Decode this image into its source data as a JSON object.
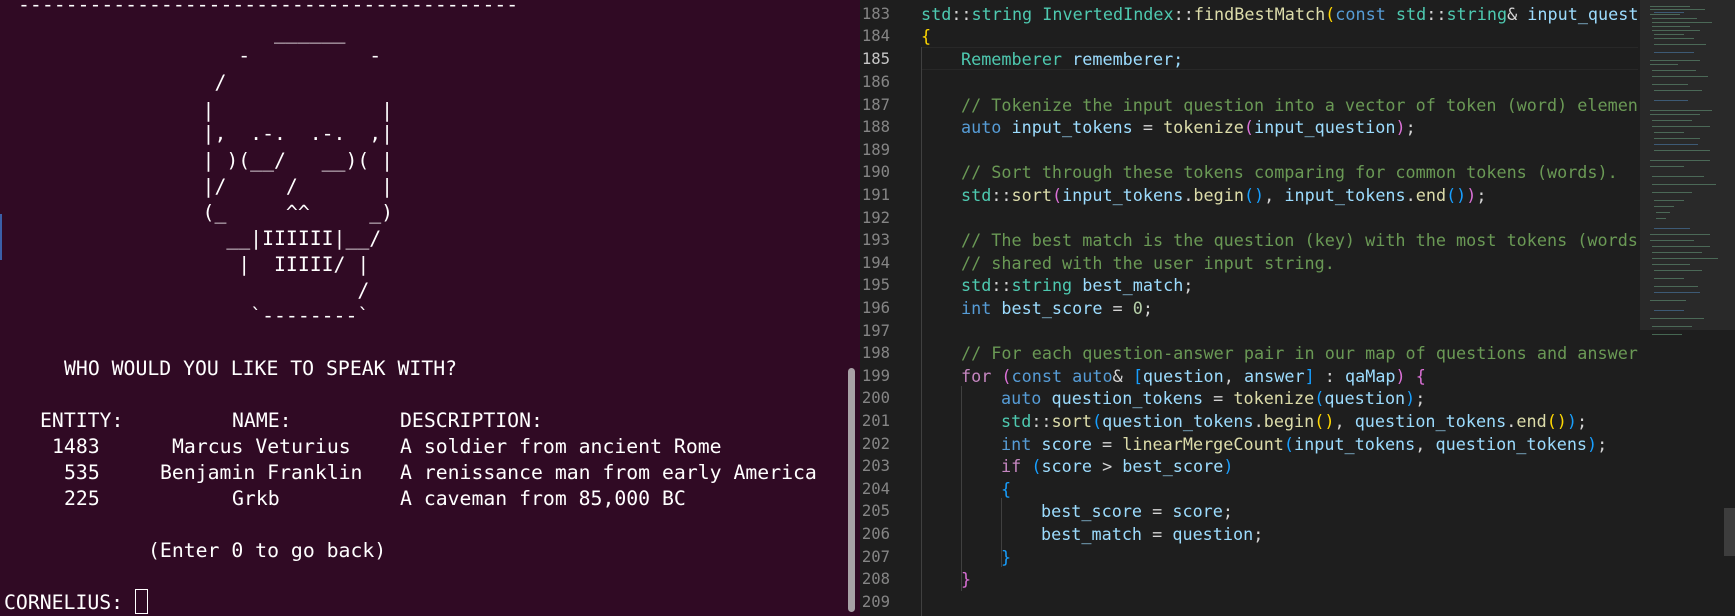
{
  "terminal": {
    "rule": "------------------------------------------",
    "ascii_art": [
      "           ______",
      "        -          -",
      "      /",
      "     |              |",
      "     |,  .-.  .-.  ,|",
      "     | )(__/   __)( |",
      "     |/     /       |",
      "     (_     ^^     _)",
      "       __|IIIIII|__/",
      "        |  IIIII/ |",
      "                  /",
      "         `--------`"
    ],
    "prompt_heading": "WHO WOULD YOU LIKE TO SPEAK WITH?",
    "table": {
      "headers": [
        "ENTITY:",
        "NAME:",
        "DESCRIPTION:"
      ],
      "rows": [
        {
          "entity": "1483",
          "name": "Marcus Veturius",
          "description": "A soldier from ancient Rome"
        },
        {
          "entity": "535",
          "name": "Benjamin Franklin",
          "description": "A renissance man from early America"
        },
        {
          "entity": "225",
          "name": "Grkb",
          "description": "A caveman from 85,000 BC"
        }
      ]
    },
    "back_hint": "(Enter 0 to go back)",
    "input_prompt": "CORNELIUS:",
    "input_value": ""
  },
  "editor": {
    "line_numbers": [
      "183",
      "184",
      "185",
      "186",
      "187",
      "188",
      "189",
      "190",
      "191",
      "192",
      "193",
      "194",
      "195",
      "196",
      "197",
      "198",
      "199",
      "200",
      "201",
      "202",
      "203",
      "204",
      "205",
      "206",
      "207",
      "208",
      "209"
    ],
    "active_line": "185",
    "code": {
      "l183": {
        "a": "std",
        "b": "::",
        "c": "string",
        "d": " InvertedIndex",
        "e": "::",
        "f": "findBestMatch",
        "g": "(",
        "h": "const",
        "i": " std",
        "j": "::",
        "k": "string",
        "l": "& ",
        "m": "input_quest"
      },
      "l184": {
        "a": "{"
      },
      "l185": {
        "a": "Rememberer",
        "b": " rememberer;"
      },
      "l187": {
        "a": "// Tokenize the input question into a vector of token (word) elemen"
      },
      "l188": {
        "a": "auto",
        "b": " input_tokens",
        "c": " = ",
        "d": "tokenize",
        "e": "(",
        "f": "input_question",
        "g": ")",
        "h": ";"
      },
      "l190": {
        "a": "// Sort through these tokens comparing for common tokens (words)."
      },
      "l191": {
        "a": "std",
        "b": "::",
        "c": "sort",
        "d": "(",
        "e": "input_tokens",
        "f": ".",
        "g": "begin",
        "h": "()",
        "i": ", ",
        "j": "input_tokens",
        "k": ".",
        "l": "end",
        "m": "()",
        "n": ")",
        "o": ";"
      },
      "l193": {
        "a": "// The best match is the question (key) with the most tokens (words"
      },
      "l194": {
        "a": "// shared with the user input string."
      },
      "l195": {
        "a": "std",
        "b": "::",
        "c": "string",
        "d": " best_match",
        "e": ";"
      },
      "l196": {
        "a": "int",
        "b": " best_score",
        "c": " = ",
        "d": "0",
        "e": ";"
      },
      "l198": {
        "a": "// For each question-answer pair in our map of questions and answer"
      },
      "l199": {
        "a": "for",
        "b": " (",
        "c": "const",
        "d": " auto",
        "e": "& ",
        "f": "[",
        "g": "question",
        "h": ", ",
        "i": "answer",
        "j": "]",
        "k": " : ",
        "l": "qaMap",
        "m": ")",
        "n": " {"
      },
      "l200": {
        "a": "auto",
        "b": " question_tokens",
        "c": " = ",
        "d": "tokenize",
        "e": "(",
        "f": "question",
        "g": ")",
        "h": ";"
      },
      "l201": {
        "a": "std",
        "b": "::",
        "c": "sort",
        "d": "(",
        "e": "question_tokens",
        "f": ".",
        "g": "begin",
        "h": "()",
        "i": ", ",
        "j": "question_tokens",
        "k": ".",
        "l": "end",
        "m": "()",
        "n": ")",
        "o": ";"
      },
      "l202": {
        "a": "int",
        "b": " score",
        "c": " = ",
        "d": "linearMergeCount",
        "e": "(",
        "f": "input_tokens",
        "g": ", ",
        "h": "question_tokens",
        "i": ")",
        "j": ";"
      },
      "l203": {
        "a": "if",
        "b": " (",
        "c": "score",
        "d": " > ",
        "e": "best_score",
        "f": ")"
      },
      "l204": {
        "a": "{"
      },
      "l205": {
        "a": "best_score",
        "b": " = ",
        "c": "score",
        "d": ";"
      },
      "l206": {
        "a": "best_match",
        "b": " = ",
        "c": "question",
        "d": ";"
      },
      "l207": {
        "a": "}"
      },
      "l208": {
        "a": "}"
      }
    }
  },
  "colors": {
    "terminal_bg": "#300a24",
    "editor_bg": "#1e1e1e",
    "comment": "#6a9955",
    "type": "#4ec9b0",
    "keyword": "#569cd6",
    "control": "#c586c0",
    "function": "#dcdcaa",
    "variable": "#9cdcfe",
    "number": "#b5cea8"
  }
}
